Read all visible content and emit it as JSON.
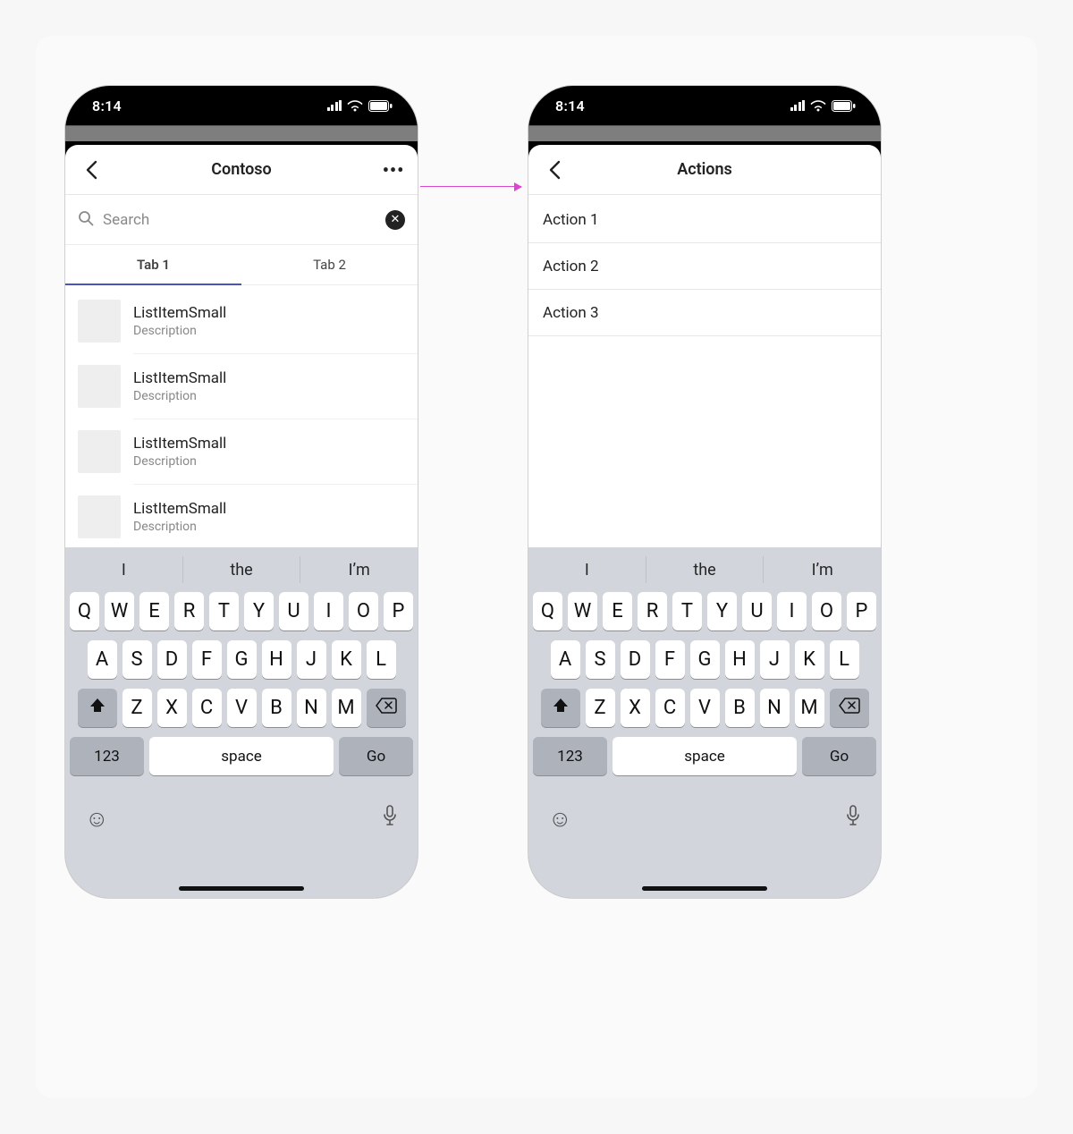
{
  "status": {
    "time": "8:14"
  },
  "screenA": {
    "title": "Contoso",
    "search_placeholder": "Search",
    "tabs": [
      "Tab 1",
      "Tab 2"
    ],
    "active_tab_index": 0,
    "items": [
      {
        "title": "ListItemSmall",
        "desc": "Description"
      },
      {
        "title": "ListItemSmall",
        "desc": "Description"
      },
      {
        "title": "ListItemSmall",
        "desc": "Description"
      },
      {
        "title": "ListItemSmall",
        "desc": "Description"
      }
    ]
  },
  "screenB": {
    "title": "Actions",
    "actions": [
      "Action 1",
      "Action 2",
      "Action 3"
    ]
  },
  "keyboard": {
    "suggestions": [
      "I",
      "the",
      "I’m"
    ],
    "row1": [
      "Q",
      "W",
      "E",
      "R",
      "T",
      "Y",
      "U",
      "I",
      "O",
      "P"
    ],
    "row2": [
      "A",
      "S",
      "D",
      "F",
      "G",
      "H",
      "J",
      "K",
      "L"
    ],
    "row3": [
      "Z",
      "X",
      "C",
      "V",
      "B",
      "N",
      "M"
    ],
    "num_label": "123",
    "space_label": "space",
    "go_label": "Go"
  }
}
